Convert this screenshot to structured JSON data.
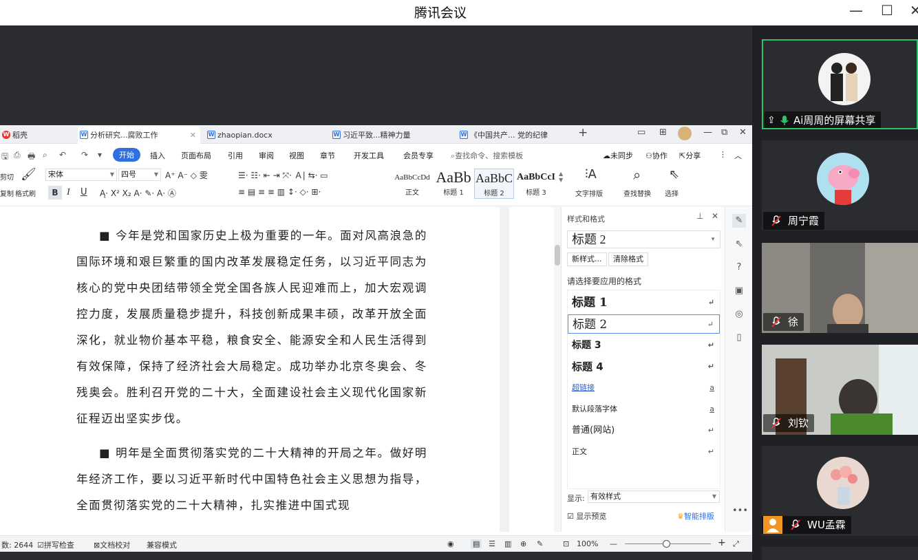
{
  "meeting": {
    "title": "腾讯会议",
    "min_btn": "—",
    "max_btn": "☐",
    "close_btn": "✕"
  },
  "wps": {
    "tabs": [
      {
        "label": "稻壳"
      },
      {
        "label": "分析研究...腐败工作"
      },
      {
        "label": "zhaopian.docx"
      },
      {
        "label": "习近平致...精神力量"
      },
      {
        "label": "《中国共产... 党的纪律"
      }
    ],
    "tab_add": "+",
    "menu": {
      "start": "开始",
      "insert": "插入",
      "layout": "页面布局",
      "reference": "引用",
      "review": "审阅",
      "view": "视图",
      "section": "章节",
      "dev": "开发工具",
      "member": "会员专享",
      "search": "查找命令、搜索模板",
      "sync": "未同步",
      "collab": "协作",
      "share": "分享"
    },
    "ribbon": {
      "cut": "剪切",
      "copy": "复制",
      "format_painter": "格式刷",
      "font": "宋体",
      "size": "四号",
      "bold": "B",
      "italic": "I",
      "underline": "U",
      "styles": [
        {
          "sample": "AaBbCcDd",
          "name": "正文"
        },
        {
          "sample": "AaBb",
          "name": "标题 1"
        },
        {
          "sample": "AaBbC",
          "name": "标题 2"
        },
        {
          "sample": "AaBbCcI",
          "name": "标题 3"
        }
      ],
      "text_layout": "文字排版",
      "find_replace": "查找替换",
      "select": "选择"
    },
    "document": {
      "paragraphs": [
        "■ 今年是党和国家历史上极为重要的一年。面对风高浪急的国际环境和艰巨繁重的国内改革发展稳定任务，以习近平同志为核心的党中央团结带领全党全国各族人民迎难而上，加大宏观调控力度，发展质量稳步提升，科技创新成果丰硕，改革开放全面深化，就业物价基本平稳，粮食安全、能源安全和人民生活得到有效保障，保持了经济社会大局稳定。成功举办北京冬奥会、冬残奥会。胜利召开党的二十大，全面建设社会主义现代化国家新征程迈出坚实步伐。",
        "■ 明年是全面贯彻落实党的二十大精神的开局之年。做好明年经济工作，要以习近平新时代中国特色社会主义思想为指导，全面贯彻落实党的二十大精神，扎实推进中国式现"
      ]
    },
    "pane": {
      "header": "样式和格式",
      "current": "标题 2",
      "new_style": "新样式...",
      "clear_format": "清除格式",
      "apply_label": "请选择要应用的格式",
      "items": [
        {
          "label": "标题 1",
          "mark": "↵"
        },
        {
          "label": "标题 2",
          "mark": "↵"
        },
        {
          "label": "标题 3",
          "mark": "↵"
        },
        {
          "label": "标题 4",
          "mark": "↵"
        },
        {
          "label": "超链接",
          "mark": "a"
        },
        {
          "label": "默认段落字体",
          "mark": "a"
        },
        {
          "label": "普通(网站)",
          "mark": "↵"
        },
        {
          "label": "正文",
          "mark": "↵"
        }
      ],
      "show_label": "显示:",
      "show_value": "有效样式",
      "preview": "显示预览",
      "smart": "智能排版"
    },
    "status": {
      "word_count": "数: 2644",
      "spell": "拼写检查",
      "proof": "文档校对",
      "compat": "兼容模式",
      "zoom": "100%"
    }
  },
  "participants": [
    {
      "name": "Ai周周的屏幕共享"
    },
    {
      "name": "周宁霞"
    },
    {
      "name": "徐"
    },
    {
      "name": "刘钦"
    },
    {
      "name": "WU孟霖"
    }
  ],
  "more": "•••"
}
